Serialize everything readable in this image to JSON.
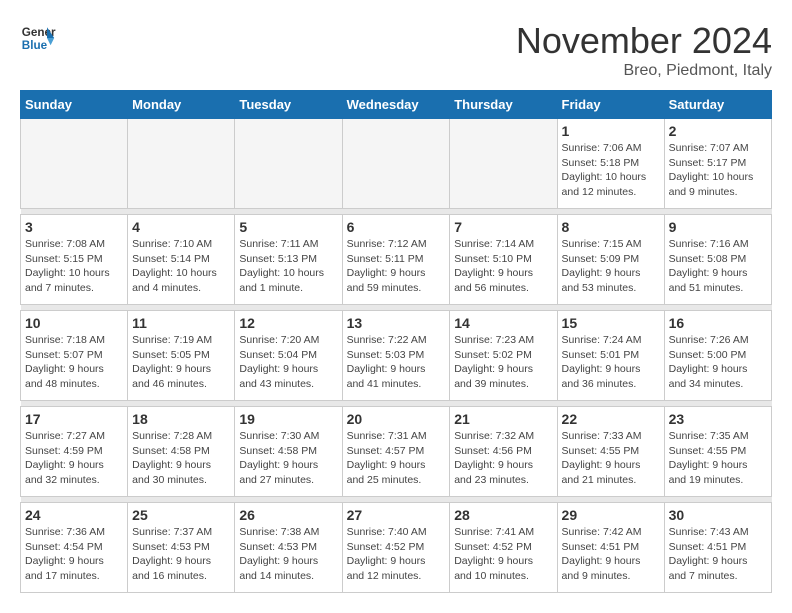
{
  "logo": {
    "line1": "General",
    "line2": "Blue"
  },
  "title": "November 2024",
  "location": "Breo, Piedmont, Italy",
  "days_header": [
    "Sunday",
    "Monday",
    "Tuesday",
    "Wednesday",
    "Thursday",
    "Friday",
    "Saturday"
  ],
  "weeks": [
    [
      {
        "day": "",
        "info": ""
      },
      {
        "day": "",
        "info": ""
      },
      {
        "day": "",
        "info": ""
      },
      {
        "day": "",
        "info": ""
      },
      {
        "day": "",
        "info": ""
      },
      {
        "day": "1",
        "info": "Sunrise: 7:06 AM\nSunset: 5:18 PM\nDaylight: 10 hours and 12 minutes."
      },
      {
        "day": "2",
        "info": "Sunrise: 7:07 AM\nSunset: 5:17 PM\nDaylight: 10 hours and 9 minutes."
      }
    ],
    [
      {
        "day": "3",
        "info": "Sunrise: 7:08 AM\nSunset: 5:15 PM\nDaylight: 10 hours and 7 minutes."
      },
      {
        "day": "4",
        "info": "Sunrise: 7:10 AM\nSunset: 5:14 PM\nDaylight: 10 hours and 4 minutes."
      },
      {
        "day": "5",
        "info": "Sunrise: 7:11 AM\nSunset: 5:13 PM\nDaylight: 10 hours and 1 minute."
      },
      {
        "day": "6",
        "info": "Sunrise: 7:12 AM\nSunset: 5:11 PM\nDaylight: 9 hours and 59 minutes."
      },
      {
        "day": "7",
        "info": "Sunrise: 7:14 AM\nSunset: 5:10 PM\nDaylight: 9 hours and 56 minutes."
      },
      {
        "day": "8",
        "info": "Sunrise: 7:15 AM\nSunset: 5:09 PM\nDaylight: 9 hours and 53 minutes."
      },
      {
        "day": "9",
        "info": "Sunrise: 7:16 AM\nSunset: 5:08 PM\nDaylight: 9 hours and 51 minutes."
      }
    ],
    [
      {
        "day": "10",
        "info": "Sunrise: 7:18 AM\nSunset: 5:07 PM\nDaylight: 9 hours and 48 minutes."
      },
      {
        "day": "11",
        "info": "Sunrise: 7:19 AM\nSunset: 5:05 PM\nDaylight: 9 hours and 46 minutes."
      },
      {
        "day": "12",
        "info": "Sunrise: 7:20 AM\nSunset: 5:04 PM\nDaylight: 9 hours and 43 minutes."
      },
      {
        "day": "13",
        "info": "Sunrise: 7:22 AM\nSunset: 5:03 PM\nDaylight: 9 hours and 41 minutes."
      },
      {
        "day": "14",
        "info": "Sunrise: 7:23 AM\nSunset: 5:02 PM\nDaylight: 9 hours and 39 minutes."
      },
      {
        "day": "15",
        "info": "Sunrise: 7:24 AM\nSunset: 5:01 PM\nDaylight: 9 hours and 36 minutes."
      },
      {
        "day": "16",
        "info": "Sunrise: 7:26 AM\nSunset: 5:00 PM\nDaylight: 9 hours and 34 minutes."
      }
    ],
    [
      {
        "day": "17",
        "info": "Sunrise: 7:27 AM\nSunset: 4:59 PM\nDaylight: 9 hours and 32 minutes."
      },
      {
        "day": "18",
        "info": "Sunrise: 7:28 AM\nSunset: 4:58 PM\nDaylight: 9 hours and 30 minutes."
      },
      {
        "day": "19",
        "info": "Sunrise: 7:30 AM\nSunset: 4:58 PM\nDaylight: 9 hours and 27 minutes."
      },
      {
        "day": "20",
        "info": "Sunrise: 7:31 AM\nSunset: 4:57 PM\nDaylight: 9 hours and 25 minutes."
      },
      {
        "day": "21",
        "info": "Sunrise: 7:32 AM\nSunset: 4:56 PM\nDaylight: 9 hours and 23 minutes."
      },
      {
        "day": "22",
        "info": "Sunrise: 7:33 AM\nSunset: 4:55 PM\nDaylight: 9 hours and 21 minutes."
      },
      {
        "day": "23",
        "info": "Sunrise: 7:35 AM\nSunset: 4:55 PM\nDaylight: 9 hours and 19 minutes."
      }
    ],
    [
      {
        "day": "24",
        "info": "Sunrise: 7:36 AM\nSunset: 4:54 PM\nDaylight: 9 hours and 17 minutes."
      },
      {
        "day": "25",
        "info": "Sunrise: 7:37 AM\nSunset: 4:53 PM\nDaylight: 9 hours and 16 minutes."
      },
      {
        "day": "26",
        "info": "Sunrise: 7:38 AM\nSunset: 4:53 PM\nDaylight: 9 hours and 14 minutes."
      },
      {
        "day": "27",
        "info": "Sunrise: 7:40 AM\nSunset: 4:52 PM\nDaylight: 9 hours and 12 minutes."
      },
      {
        "day": "28",
        "info": "Sunrise: 7:41 AM\nSunset: 4:52 PM\nDaylight: 9 hours and 10 minutes."
      },
      {
        "day": "29",
        "info": "Sunrise: 7:42 AM\nSunset: 4:51 PM\nDaylight: 9 hours and 9 minutes."
      },
      {
        "day": "30",
        "info": "Sunrise: 7:43 AM\nSunset: 4:51 PM\nDaylight: 9 hours and 7 minutes."
      }
    ]
  ]
}
